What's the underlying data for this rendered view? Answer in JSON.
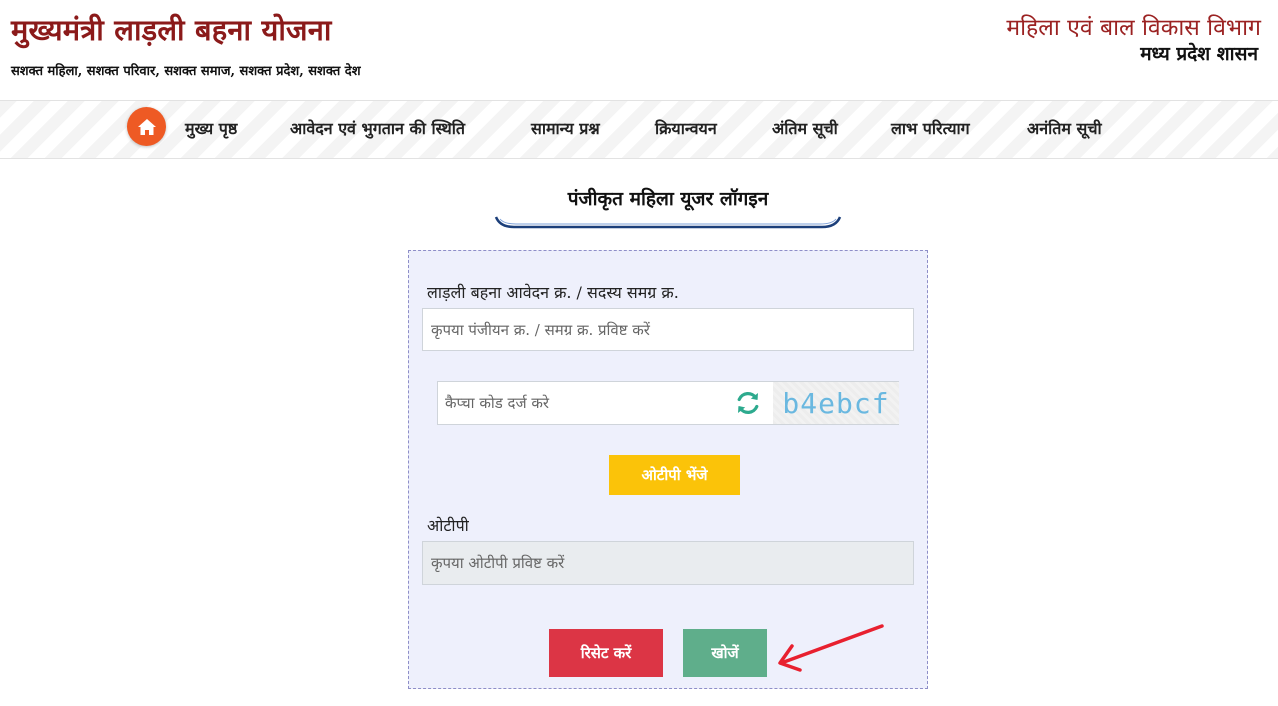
{
  "header": {
    "title": "मुख्यमंत्री लाड़ली बहना योजना",
    "tagline": "सशक्त महिला, सशक्त परिवार, सशक्त समाज, सशक्त प्रदेश, सशक्त देश",
    "department": "महिला एवं बाल विकास विभाग",
    "government": "मध्य प्रदेश शासन"
  },
  "nav": {
    "home_icon": "home-icon",
    "items": [
      {
        "label": "मुख्य पृष्ठ"
      },
      {
        "label": "आवेदन एवं भुगतान की स्थिति"
      },
      {
        "label": "सामान्य प्रश्न"
      },
      {
        "label": "क्रियान्वयन"
      },
      {
        "label": "अंतिम सूची"
      },
      {
        "label": "लाभ परित्याग"
      },
      {
        "label": "अनंतिम सूची"
      }
    ]
  },
  "login": {
    "title": "पंजीकृत महिला यूजर लॉगइन",
    "application_label": "लाड़ली बहना आवेदन क्र. / सदस्य समग्र क्र.",
    "application_placeholder": "कृपया पंजीयन क्र. / समग्र क्र. प्रविष्ट करें",
    "captcha_placeholder": "कैप्चा कोड दर्ज करे",
    "captcha_code": "b4ebcf",
    "send_otp_label": "ओटीपी भेंजे",
    "otp_label": "ओटीपी",
    "otp_placeholder": "कृपया ओटीपी प्रविष्ट करें",
    "reset_label": "रिसेट करें",
    "search_label": "खोजें"
  },
  "colors": {
    "title_red": "#8b1a1a",
    "home_orange": "#ee5a24",
    "otp_yellow": "#fbc309",
    "reset_red": "#dc3545",
    "search_green": "#5fae8b",
    "panel_bg": "#eef0fc",
    "arrow_red": "#e8202f"
  }
}
